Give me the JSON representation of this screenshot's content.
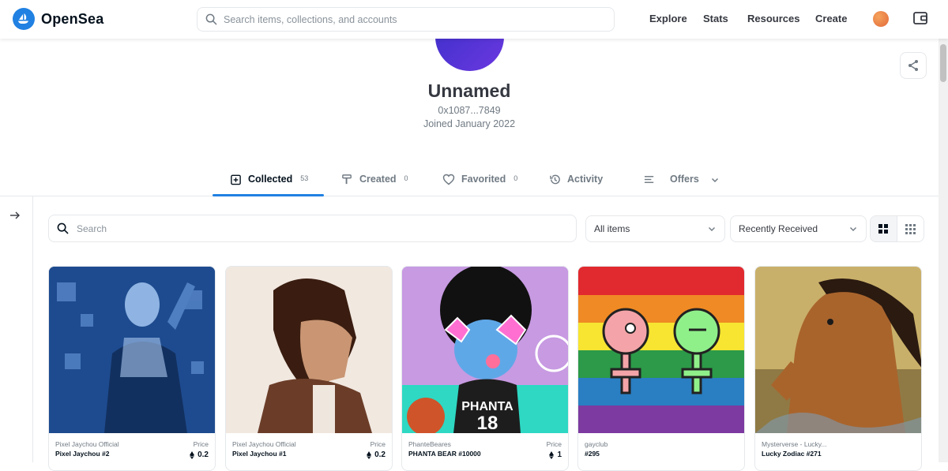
{
  "header": {
    "brand": "OpenSea",
    "search_placeholder": "Search items, collections, and accounts",
    "nav": [
      "Explore",
      "Stats",
      "Resources",
      "Create"
    ]
  },
  "profile": {
    "name": "Unnamed",
    "address": "0x1087...7849",
    "joined": "Joined January 2022"
  },
  "tabs": [
    {
      "label": "Collected",
      "count": "53",
      "icon": "collected-icon"
    },
    {
      "label": "Created",
      "count": "0",
      "icon": "brush-icon"
    },
    {
      "label": "Favorited",
      "count": "0",
      "icon": "heart-icon"
    },
    {
      "label": "Activity",
      "count": "",
      "icon": "history-icon"
    },
    {
      "label": "Offers",
      "count": "",
      "icon": "list-icon"
    }
  ],
  "filters": {
    "search_placeholder": "Search",
    "items_select": "All items",
    "sort_select": "Recently Received"
  },
  "cards": [
    {
      "collection": "Pixel Jaychou Official",
      "name": "Pixel Jaychou #2",
      "price_label": "Price",
      "price": "0.2"
    },
    {
      "collection": "Pixel Jaychou Official",
      "name": "Pixel Jaychou #1",
      "price_label": "Price",
      "price": "0.2"
    },
    {
      "collection": "PhanteBeares",
      "name": "PHANTA BEAR #10000",
      "price_label": "Price",
      "price": "1"
    },
    {
      "collection": "gayclub",
      "name": "#295",
      "price_label": "",
      "price": ""
    },
    {
      "collection": "Mysterverse - Lucky...",
      "name": "Lucky Zodiac #271",
      "price_label": "",
      "price": ""
    }
  ],
  "card_art_text": {
    "jersey_team": "PHANTA",
    "jersey_number": "18"
  },
  "colors": {
    "accent": "#2081e2",
    "text": "#04111d",
    "muted": "#707a83",
    "border": "#e5e8eb"
  }
}
